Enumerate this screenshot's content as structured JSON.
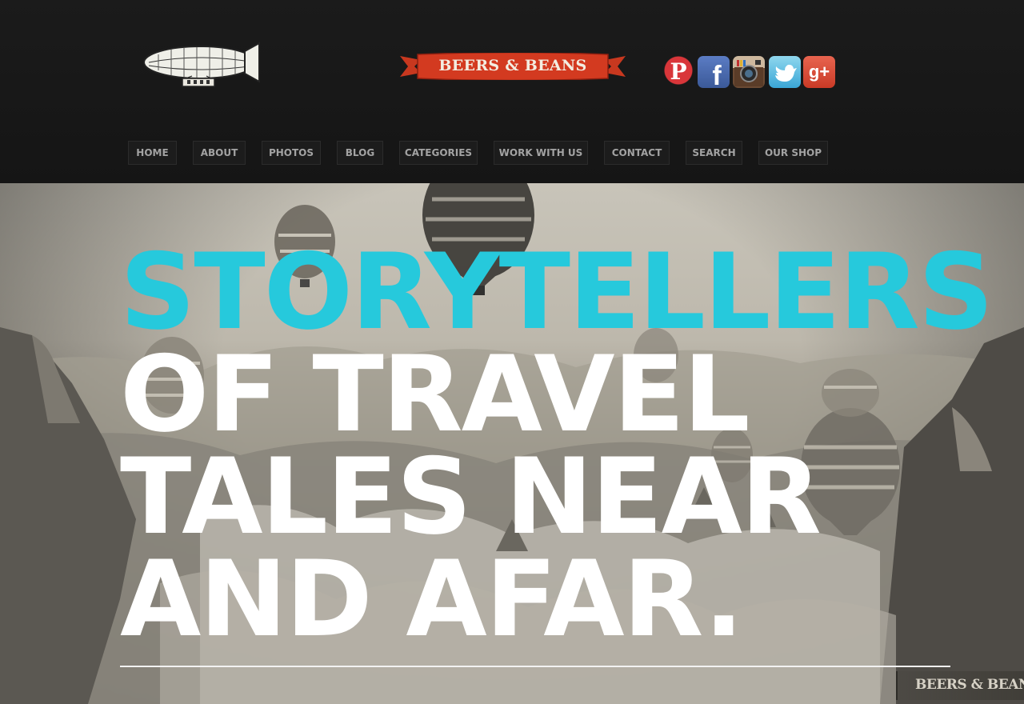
{
  "brand": {
    "name": "BEERS & BEANS"
  },
  "social": [
    {
      "name": "pinterest-icon",
      "glyph": "P",
      "color": "#d9363a"
    },
    {
      "name": "facebook-icon",
      "glyph": "f",
      "color": "#3b5998"
    },
    {
      "name": "instagram-icon",
      "glyph": "",
      "color": "#6b4a33"
    },
    {
      "name": "twitter-icon",
      "glyph": "",
      "color": "#3aa6d6"
    },
    {
      "name": "google-plus-icon",
      "glyph": "g+",
      "color": "#c93a26"
    }
  ],
  "nav": {
    "items": [
      {
        "label": "HOME"
      },
      {
        "label": "ABOUT"
      },
      {
        "label": "PHOTOS"
      },
      {
        "label": "BLOG"
      },
      {
        "label": "CATEGORIES"
      },
      {
        "label": "WORK WITH US"
      },
      {
        "label": "CONTACT"
      },
      {
        "label": "SEARCH"
      },
      {
        "label": "OUR SHOP"
      }
    ]
  },
  "hero": {
    "lines": [
      "STORYTELLERS",
      "OF TRAVEL",
      "TALES NEAR",
      "AND AFAR."
    ],
    "accent_color": "#26c9dc",
    "watermark": "BEERS & BEANS"
  }
}
